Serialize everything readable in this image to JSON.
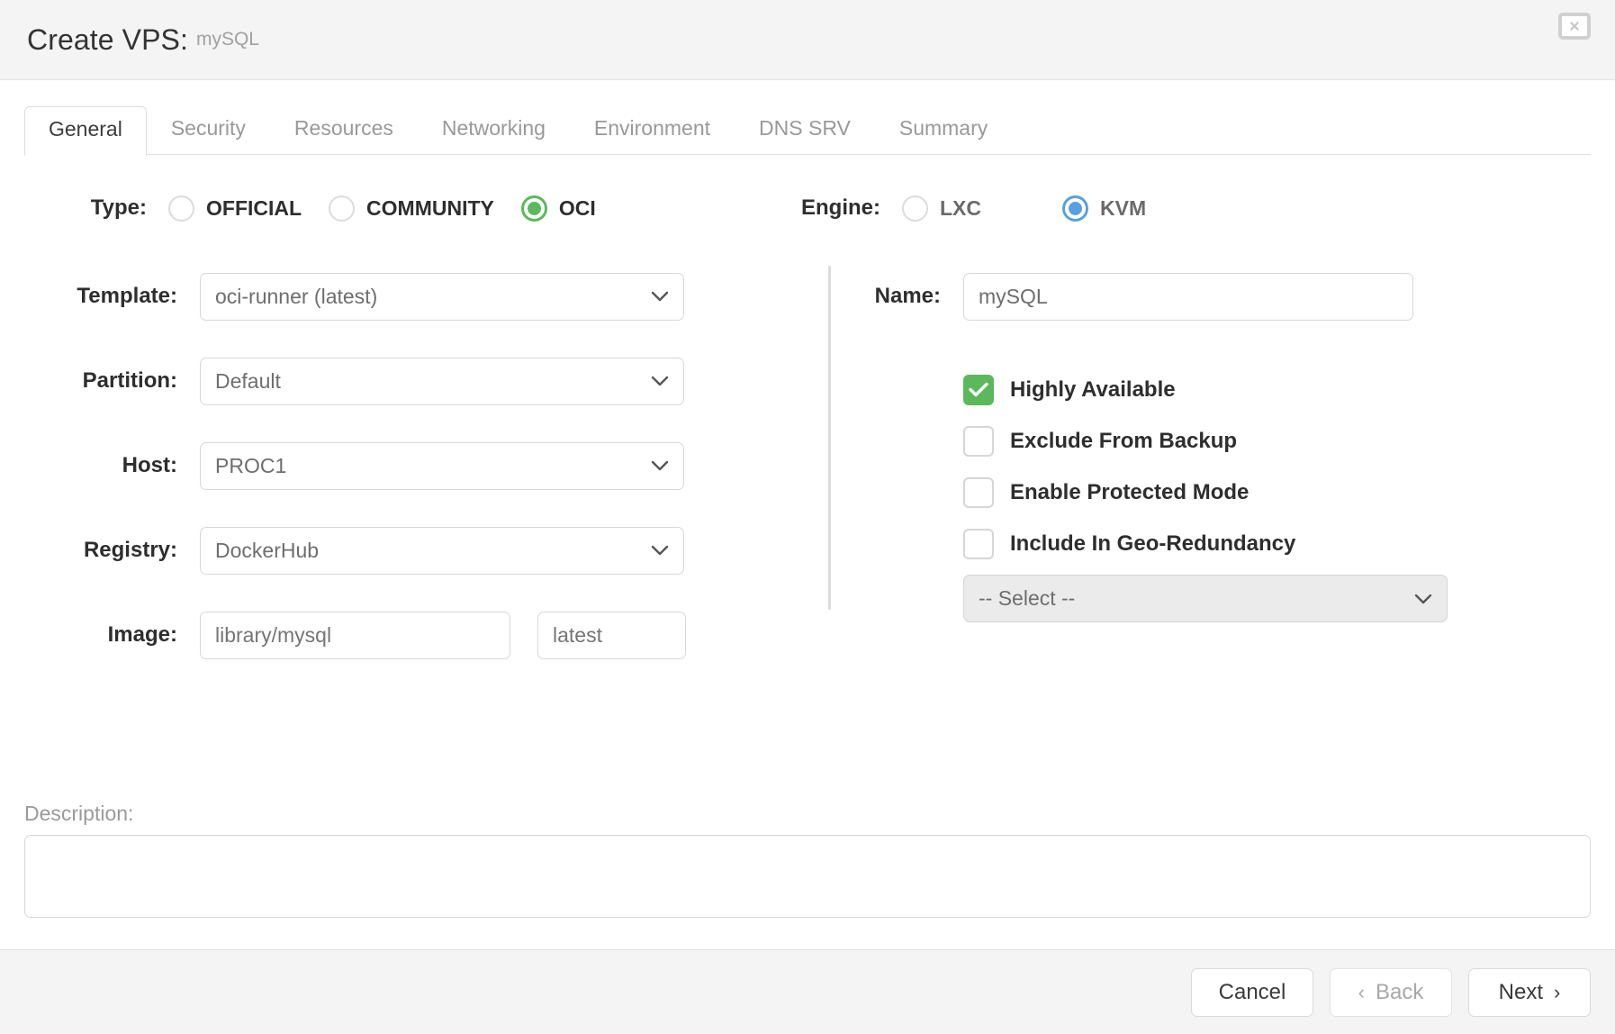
{
  "header": {
    "title": "Create VPS:",
    "subject": "mySQL",
    "close_icon": "close-icon"
  },
  "tabs": [
    {
      "label": "General",
      "active": true
    },
    {
      "label": "Security",
      "active": false
    },
    {
      "label": "Resources",
      "active": false
    },
    {
      "label": "Networking",
      "active": false
    },
    {
      "label": "Environment",
      "active": false
    },
    {
      "label": "DNS SRV",
      "active": false
    },
    {
      "label": "Summary",
      "active": false
    }
  ],
  "type_group": {
    "label": "Type:",
    "options": [
      {
        "label": "OFFICIAL",
        "selected": false
      },
      {
        "label": "COMMUNITY",
        "selected": false
      },
      {
        "label": "OCI",
        "selected": true
      }
    ],
    "selected_color": "#5cb85c"
  },
  "engine_group": {
    "label": "Engine:",
    "options": [
      {
        "label": "LXC",
        "selected": false
      },
      {
        "label": "KVM",
        "selected": true
      }
    ],
    "selected_color": "#59a0dd"
  },
  "left_fields": {
    "template": {
      "label": "Template:",
      "value": "oci-runner (latest)"
    },
    "partition": {
      "label": "Partition:",
      "value": "Default"
    },
    "host": {
      "label": "Host:",
      "value": "PROC1"
    },
    "registry": {
      "label": "Registry:",
      "value": "DockerHub"
    },
    "image": {
      "label": "Image:",
      "repo_placeholder": "library/mysql",
      "tag_placeholder": "latest"
    }
  },
  "right_fields": {
    "name": {
      "label": "Name:",
      "value": "mySQL"
    },
    "checkboxes": [
      {
        "label": "Highly Available",
        "checked": true
      },
      {
        "label": "Exclude From Backup",
        "checked": false
      },
      {
        "label": "Enable Protected Mode",
        "checked": false
      },
      {
        "label": "Include In Geo-Redundancy",
        "checked": false
      }
    ],
    "geo_select": {
      "value": "-- Select --",
      "disabled": true
    }
  },
  "description": {
    "label": "Description:",
    "value": "",
    "placeholder": ""
  },
  "footer": {
    "cancel_label": "Cancel",
    "back_label": "Back",
    "back_caret": "‹",
    "next_label": "Next",
    "next_caret": "›"
  }
}
